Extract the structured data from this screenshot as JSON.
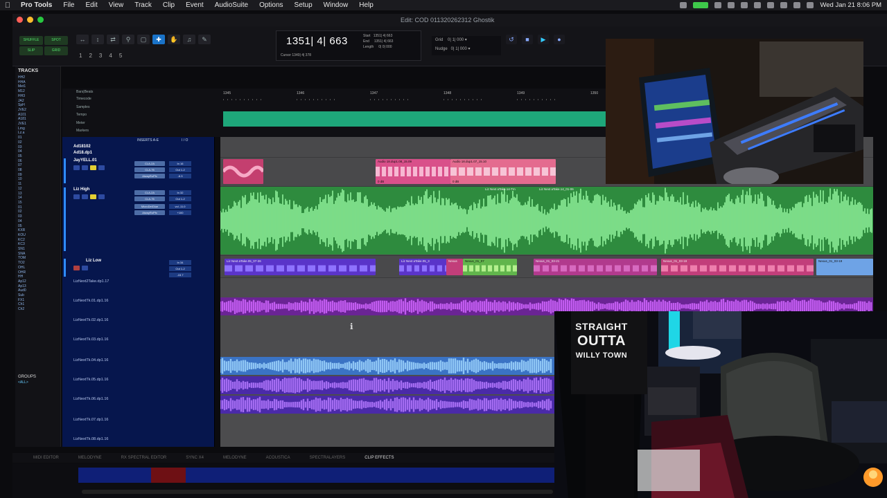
{
  "menubar": {
    "app": "Pro Tools",
    "items": [
      "File",
      "Edit",
      "View",
      "Track",
      "Clip",
      "Event",
      "AudioSuite",
      "Options",
      "Setup",
      "Window",
      "Help"
    ],
    "clock": "Wed Jan 21 8:06 PM"
  },
  "window": {
    "title": "Edit: COD 011320262312 Ghostik"
  },
  "toolbar": {
    "modes": [
      "SHUFFLE",
      "SPOT",
      "SLIP",
      "GRID"
    ],
    "zoom_presets": [
      "1",
      "2",
      "3",
      "4",
      "5"
    ],
    "main_counter": "1351| 4| 663",
    "selection": "Start   1351| 4| 663\nEnd     1351| 4| 663\nLength     0| 0| 000",
    "cursor": "Cursor   1340| 4| 378",
    "grid": "Grid    0| 1| 000 ▾\nNudge   0| 1| 000 ▾"
  },
  "tracks_panel": {
    "header": "TRACKS",
    "items": [
      "HH2",
      "HHA",
      "Met1",
      "M12",
      "HH3",
      "JA2",
      "SpH",
      "JVE2",
      "A101",
      "A181",
      "JVE1",
      "Lmg",
      "Lz.a",
      "01",
      "02",
      "03",
      "04",
      "05",
      "06",
      "07",
      "08",
      "09",
      "10",
      "11",
      "12",
      "13",
      "14",
      "15",
      "01",
      "02",
      "03",
      "04",
      "05",
      "KXR",
      "KOU",
      "KC2",
      "KC3",
      "SN1",
      "SNA",
      "TOM",
      "TO2",
      "OHL",
      "OHR",
      "HH",
      "Ap12",
      "Ap13",
      "Aud0",
      "Sub",
      "FX1",
      "Ch1",
      "Ch2"
    ],
    "groups_header": "GROUPS",
    "groups_all": "<ALL>"
  },
  "rulers": {
    "labels": [
      "Bars|Beats",
      "Timecode",
      "Samples",
      "Tempo",
      "Meter",
      "Markers"
    ],
    "bars": [
      "1345",
      "1346",
      "1347",
      "1348",
      "1349",
      "1350"
    ]
  },
  "track_headers": {
    "inserts_label": "INSERTS A-E",
    "io_label": "I / O",
    "tracks": [
      {
        "name": "Ad18102",
        "inserts": [],
        "io": []
      },
      {
        "name": "Ad18.dp1",
        "inserts": [],
        "io": []
      },
      {
        "name": "JayYELL.01",
        "inserts": [
          "CLA-2A",
          "CLA-76",
          "AlwayRoPfx"
        ],
        "io": [
          "In 16",
          "Out 1-2",
          "-6.3"
        ]
      },
      {
        "name": "Liz High",
        "inserts": [
          "CLA-2A",
          "CLA-76",
          "MicroDelGlue",
          "AlwayRoPfx"
        ],
        "io": [
          "In 32",
          "Out 1-2",
          "vol -11.0",
          "+100"
        ]
      },
      {
        "name": "Liz Low",
        "inserts": [],
        "io": [
          "In 34",
          "Out 1-2",
          "-15.7"
        ]
      },
      {
        "name": "LizNext2Take.dp1.17",
        "inserts": [],
        "io": []
      },
      {
        "name": "LizNextTk.01.dp1.16",
        "inserts": [],
        "io": []
      },
      {
        "name": "LizNextTk.02.dp1.16",
        "inserts": [],
        "io": []
      },
      {
        "name": "LizNextTk.03.dp1.16",
        "inserts": [],
        "io": []
      },
      {
        "name": "LizNextTk.04.dp1.16",
        "inserts": [],
        "io": []
      },
      {
        "name": "LizNextTk.05.dp1.16",
        "inserts": [],
        "io": []
      },
      {
        "name": "LizNextTk.06.dp1.16",
        "inserts": [],
        "io": []
      },
      {
        "name": "LizNextTk.07.dp1.16",
        "inserts": [],
        "io": []
      },
      {
        "name": "LizNextTk.08.dp1.16",
        "inserts": [],
        "io": []
      }
    ]
  },
  "clips": {
    "jay_a": "Audio 18.dup1.08_15.09",
    "jay_b": "Audio 18.dup1.07_15.10",
    "jay_gain": "0 dB",
    "liz_high_a": "Liz Next aTake.14-Tm",
    "liz_high_b": "Liz Next aTake.14_01-06",
    "liz_low": [
      "Liz Next aTake.05_07-26",
      "Liz Next aTake.05-1",
      "Liz Next aTake.05_3",
      "Nexus",
      "Noise",
      "Nexus_01_07",
      "Nexus_01_03-21",
      "Liz Next aTake.08_07-22",
      "Nexus_01_03-19",
      "Nexus",
      "Nexus_01_03-19"
    ]
  },
  "edit_panel": {
    "tabs": [
      "MIDI EDITOR",
      "MELODYNE",
      "RX SPECTRAL EDITOR",
      "SYNC X4",
      "MELODYNE",
      "ACOUSTICA",
      "SPECTRALAYERS",
      "CLIP EFFECTS"
    ],
    "active_tab": 7
  },
  "webcam": {
    "shirt_lines": [
      "STRAIGHT",
      "OUTTA",
      "WILLY TOWN"
    ]
  },
  "colors": {
    "accent_blue": "#1a73c8",
    "tempo_teal": "#1ea77a",
    "clip_green": "#7de07d",
    "clip_pink": "#d9508a",
    "clip_purple": "#9b3ec8",
    "clip_blue": "#6ea3e6",
    "header_navy": "#06164d"
  }
}
